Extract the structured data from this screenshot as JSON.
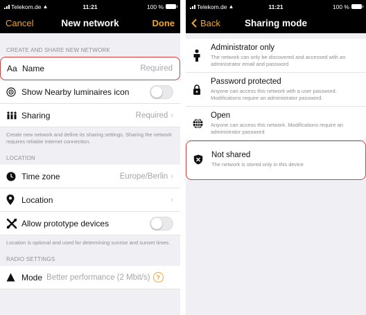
{
  "colors": {
    "accent": "#f5a623",
    "highlight_border": "#d63a3a",
    "bar_bg": "#000000",
    "group_bg": "#efeff4"
  },
  "left": {
    "status": {
      "carrier": "Telekom.de",
      "time": "11:21",
      "battery": "100 %"
    },
    "nav": {
      "cancel": "Cancel",
      "title": "New network",
      "done": "Done"
    },
    "section_create": "CREATE AND SHARE NEW NETWORK",
    "name_row": {
      "icon_text": "Aa",
      "label": "Name",
      "placeholder": "Required"
    },
    "nearby_row": {
      "icon": "eye-circle-icon",
      "label": "Show Nearby luminaires icon",
      "toggle_on": false
    },
    "sharing_row": {
      "icon": "people-icon",
      "label": "Sharing",
      "value": "Required"
    },
    "create_note": "Create new network and define its sharing settings. Sharing the network requires reliable Internet connection.",
    "section_location": "LOCATION",
    "timezone_row": {
      "icon": "clock-icon",
      "label": "Time zone",
      "value": "Europe/Berlin"
    },
    "location_row": {
      "icon": "location-pin-icon",
      "label": "Location",
      "value": ""
    },
    "prototype_row": {
      "icon": "tools-icon",
      "label": "Allow prototype devices",
      "toggle_on": false
    },
    "location_note": "Location is optional and used for determining sunrise and sunset times.",
    "section_radio": "RADIO SETTINGS",
    "mode_row": {
      "icon": "triangle-icon",
      "label": "Mode",
      "value": "Better performance (2 Mbit/s)"
    }
  },
  "right": {
    "status": {
      "carrier": "Telekom.de",
      "time": "11:21",
      "battery": "100 %"
    },
    "nav": {
      "back": "Back",
      "title": "Sharing mode"
    },
    "options": [
      {
        "icon": "admin-person-icon",
        "title": "Administrator only",
        "desc": "The network can only be discovered and accessed with an administrator email and password"
      },
      {
        "icon": "padlock-icon",
        "title": "Password protected",
        "desc": "Anyone can access this network with a user password. Modifications require an administrator password."
      },
      {
        "icon": "globe-icon",
        "title": "Open",
        "desc": "Anyone can access this network. Modifications require an administrator password"
      },
      {
        "icon": "shield-x-icon",
        "title": "Not shared",
        "desc": "The network is stored only in this device"
      }
    ]
  }
}
